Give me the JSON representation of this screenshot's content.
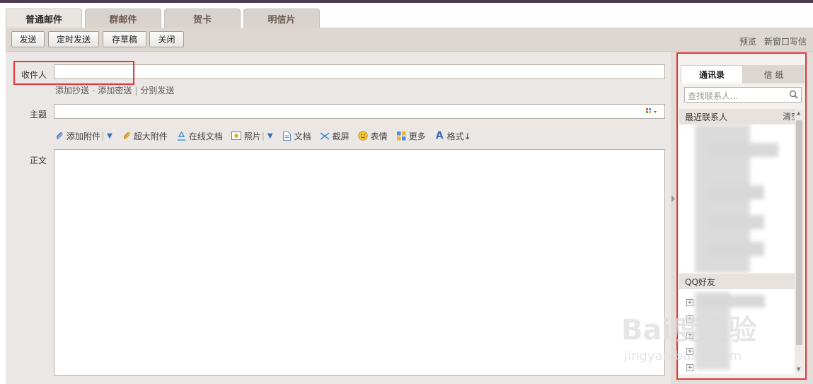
{
  "tabs": [
    {
      "label": "普通邮件",
      "active": true
    },
    {
      "label": "群邮件",
      "active": false
    },
    {
      "label": "贺卡",
      "active": false
    },
    {
      "label": "明信片",
      "active": false
    }
  ],
  "toolbar": {
    "send": "发送",
    "scheduled_send": "定时发送",
    "save_draft": "存草稿",
    "close": "关闭",
    "preview": "预览",
    "new_window": "新窗口写信"
  },
  "form": {
    "to_label": "收件人",
    "to_value": "",
    "add_cc": "添加抄送",
    "dash": "-",
    "add_bcc": "添加密送",
    "separator": "|",
    "separate_send": "分别发送",
    "subject_label": "主题",
    "subject_value": "",
    "body_label": "正文"
  },
  "attachments": {
    "add_attachment": "添加附件",
    "large_attachment": "超大附件",
    "online_doc": "在线文档",
    "photo": "照片",
    "document": "文档",
    "screenshot": "截屏",
    "emoji": "表情",
    "more": "更多",
    "format": "格式↓"
  },
  "panel": {
    "tab_contacts": "通讯录",
    "tab_stationery": "信 纸",
    "search_placeholder": "查找联系人...",
    "recent_contacts": "最近联系人",
    "clear": "清空",
    "qq_friends": "QQ好友"
  },
  "watermark": {
    "text": "Bai度经验",
    "url": "jingyan.baidu.com"
  },
  "colors": {
    "highlight": "#e0383b",
    "topbar": "#4d3a52",
    "accent_link": "#3a6db5"
  }
}
